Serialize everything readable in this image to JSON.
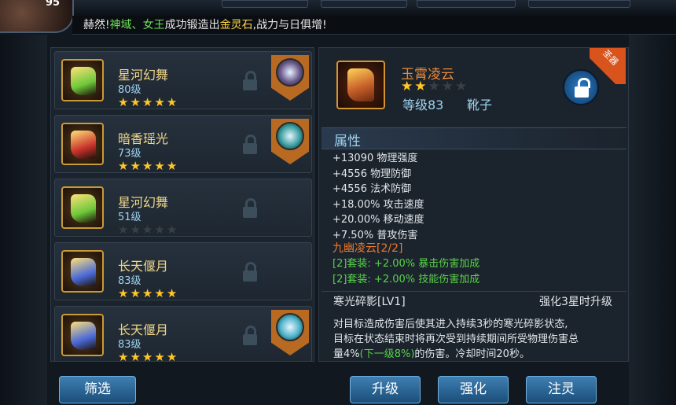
{
  "player": {
    "level": "95"
  },
  "ticker": {
    "prefix": "赫然!",
    "name1": "神域",
    "sep": "、",
    "name2": "女王",
    "middle": "成功锻造出",
    "item": "金灵石",
    "suffix": ",战力与日俱增!"
  },
  "equipment_list": [
    {
      "name": "星河幻舞",
      "level": "80级",
      "stars": 5,
      "locked": true,
      "has_badge": true,
      "boot_color": "#6ec83a"
    },
    {
      "name": "暗香瑶光",
      "level": "73级",
      "stars": 5,
      "locked": true,
      "has_badge": true,
      "boot_color": "#c8322a"
    },
    {
      "name": "星河幻舞",
      "level": "51级",
      "stars": 0,
      "locked": true,
      "has_badge": false,
      "boot_color": "#6ec83a"
    },
    {
      "name": "长天偃月",
      "level": "83级",
      "stars": 5,
      "locked": true,
      "has_badge": false,
      "boot_color": "#4a6ad8"
    },
    {
      "name": "长天偃月",
      "level": "83级",
      "stars": 5,
      "locked": true,
      "has_badge": true,
      "boot_color": "#4a6ad8"
    }
  ],
  "filter_button": "筛选",
  "detail": {
    "ribbon": "圣器",
    "name": "玉霄凌云",
    "stars_filled": 2,
    "stars_total": 5,
    "level": "等级83",
    "type": "靴子",
    "attr_header": "属性",
    "stats": [
      "+13090 物理强度",
      "+4556 物理防御",
      "+4556 法术防御",
      "+18.00% 攻击速度",
      "+20.00% 移动速度",
      "+7.50% 普攻伤害"
    ],
    "set_name": "九幽凌云[2/2]",
    "set_bonuses": [
      "[2]套装: +2.00% 暴击伤害加成",
      "[2]套装: +2.00% 技能伤害加成"
    ],
    "skill_name": "寒光碎影[LV1]",
    "skill_upgrade": "强化3星时升级",
    "skill_desc_1": "对目标造成伤害后使其进入持续3秒的寒光碎影状态,",
    "skill_desc_2": "目标在状态结束时将再次受到持续期间所受物理伤害总",
    "skill_desc_3a": "量4%",
    "skill_desc_3b": "(下一级8%)",
    "skill_desc_3c": "的伤害。冷却时间20秒。"
  },
  "actions": [
    "升级",
    "强化",
    "注灵"
  ]
}
